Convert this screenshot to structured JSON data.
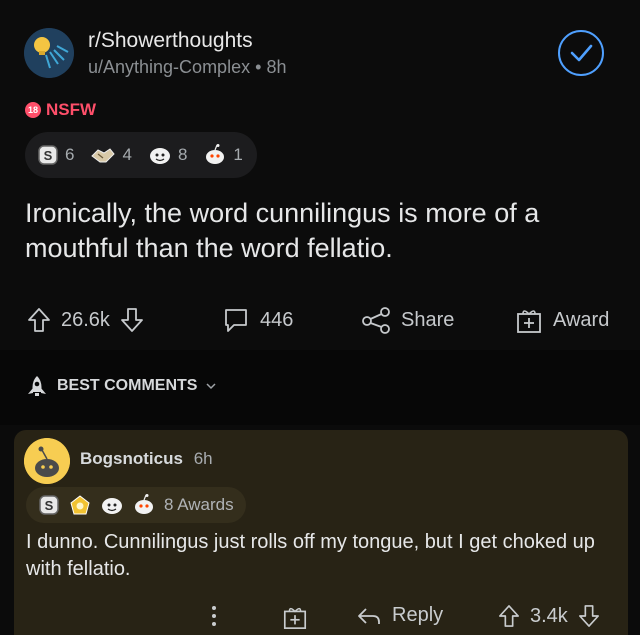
{
  "post": {
    "subreddit": "r/Showerthoughts",
    "username": "u/Anything-Complex",
    "separator": "•",
    "age": "8h",
    "nsfw_badge": "18",
    "nsfw_label": "NSFW",
    "awards": [
      {
        "icon": "silver-award-icon",
        "count": "6"
      },
      {
        "icon": "handshake-award-icon",
        "count": "4"
      },
      {
        "icon": "wholesome-award-icon",
        "count": "8"
      },
      {
        "icon": "snoo-award-icon",
        "count": "1"
      }
    ],
    "title": "Ironically, the word cunnilingus is more of a mouthful than the word fellatio.",
    "upvotes": "26.6k",
    "comments": "446",
    "share_label": "Share",
    "award_label": "Award"
  },
  "comments_section": {
    "sort_label": "BEST COMMENTS"
  },
  "comment": {
    "username": "Bogsnoticus",
    "age": "6h",
    "awards_label": "8 Awards",
    "body": "I dunno. Cunnilingus just rolls off my tongue, but I get choked up with fellatio.",
    "reply_label": "Reply",
    "score": "3.4k"
  },
  "colors": {
    "accent_blue": "#4fa0ff",
    "nsfw_red": "#ff4f6a",
    "comment_bg": "#282315"
  }
}
